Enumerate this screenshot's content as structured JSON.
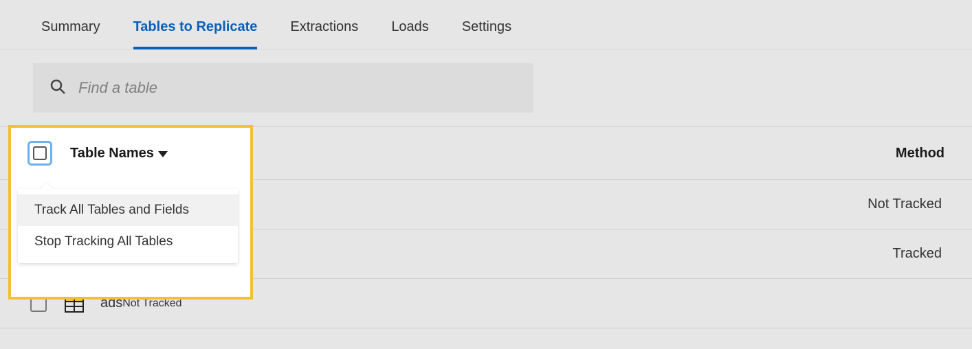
{
  "tabs": {
    "summary": "Summary",
    "tables": "Tables to Replicate",
    "extractions": "Extractions",
    "loads": "Loads",
    "settings": "Settings"
  },
  "search": {
    "placeholder": "Find a table"
  },
  "columns": {
    "table_names": "Table Names",
    "method": "Method"
  },
  "dropdown": {
    "track_all": "Track All Tables and Fields",
    "stop_all": "Stop Tracking All Tables"
  },
  "rows": [
    {
      "name": "",
      "method": "Not Tracked"
    },
    {
      "name": "",
      "method": "Tracked"
    },
    {
      "name": "ads",
      "method": "Not Tracked"
    }
  ]
}
